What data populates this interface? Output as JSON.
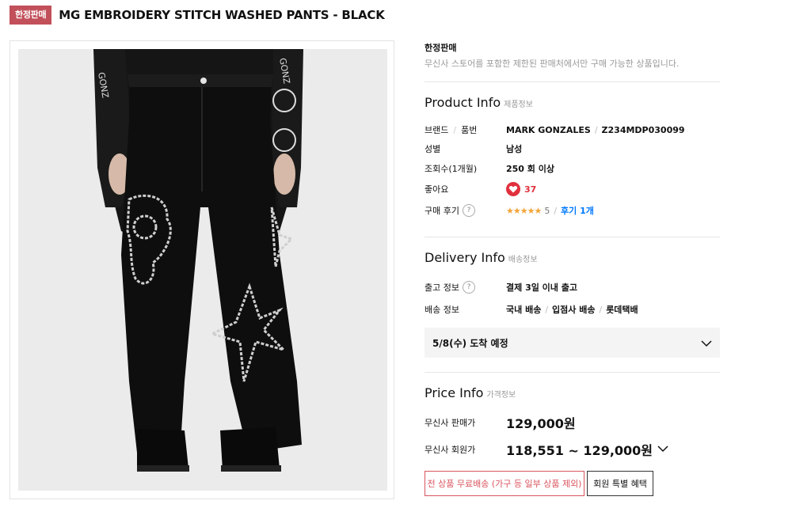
{
  "header": {
    "badge": "한정판매",
    "title": "MG EMBROIDERY STITCH WASHED PANTS - BLACK"
  },
  "limited": {
    "title": "한정판매",
    "desc": "무신사 스토어를 포함한 제한된 판매처에서만 구매 가능한 상품입니다."
  },
  "product_info": {
    "title": "Product Info",
    "sub": "제품정보",
    "brand_label": "브랜드",
    "code_label": "품번",
    "brand": "MARK GONZALES",
    "code": "Z234MDP030099",
    "gender_label": "성별",
    "gender": "남성",
    "views_label": "조회수(1개월)",
    "views": "250 회 이상",
    "likes_label": "좋아요",
    "likes": "37",
    "review_label": "구매 후기",
    "help": "?",
    "stars": "★★★★★",
    "rating": "5",
    "review_link": "후기 1개"
  },
  "delivery_info": {
    "title": "Delivery Info",
    "sub": "배송정보",
    "ship_label": "출고 정보",
    "ship_value": "결제 3일 이내 출고",
    "method_label": "배송 정보",
    "method_1": "국내 배송",
    "method_2": "입점사 배송",
    "method_3": "롯데택배",
    "arrival": "5/8(수) 도착 예정"
  },
  "price_info": {
    "title": "Price Info",
    "sub": "가격정보",
    "sale_label": "무신사 판매가",
    "sale_price": "129,000원",
    "member_label": "무신사 회원가",
    "member_price": "118,551 ~ 129,000원"
  },
  "buttons": {
    "free_shipping": "전 상품 무료배송 (가구 등 일부 상품 제외)",
    "member_benefit": "회원 특별 혜택"
  },
  "colors": {
    "badge": "#c2505a",
    "like": "#e0303d",
    "link": "#0078ff",
    "star": "#f3a53a"
  },
  "image": {
    "sleeve_text_left": "GONZ",
    "sleeve_text_right": "GONZ"
  }
}
